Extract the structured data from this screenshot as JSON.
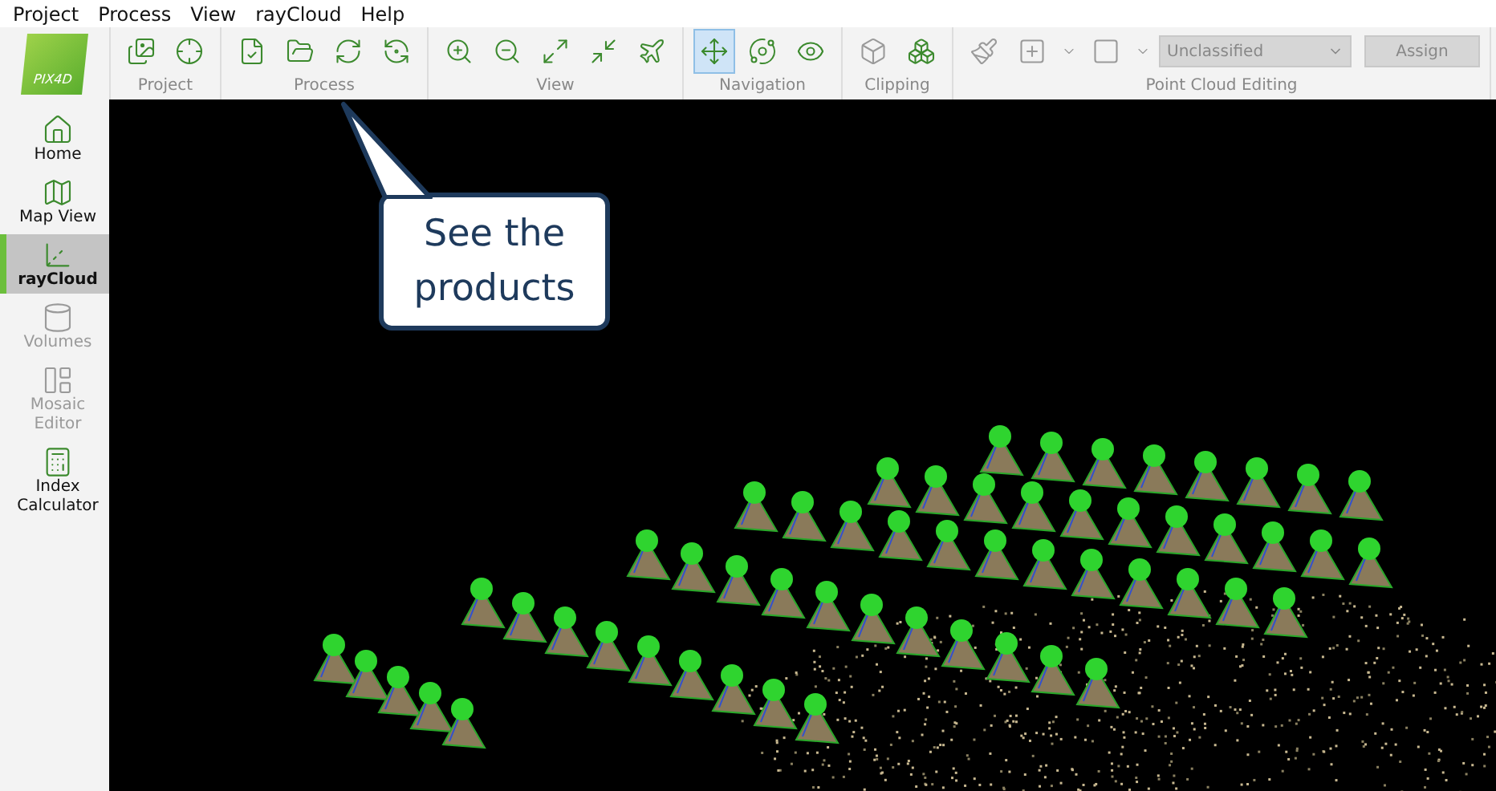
{
  "menu": [
    "Project",
    "Process",
    "View",
    "rayCloud",
    "Help"
  ],
  "logo": {
    "text": "PIX4D"
  },
  "toolbar": [
    {
      "label": "Project",
      "tools": [
        {
          "kind": "photos"
        },
        {
          "kind": "target"
        }
      ]
    },
    {
      "label": "Process",
      "tools": [
        {
          "kind": "check"
        },
        {
          "kind": "folder"
        },
        {
          "kind": "cycle"
        },
        {
          "kind": "cycle-plus"
        }
      ]
    },
    {
      "label": "View",
      "tools": [
        {
          "kind": "zoom-in"
        },
        {
          "kind": "zoom-out"
        },
        {
          "kind": "expand"
        },
        {
          "kind": "shrink"
        },
        {
          "kind": "plane"
        }
      ]
    },
    {
      "label": "Navigation",
      "tools": [
        {
          "kind": "move",
          "selected": true
        },
        {
          "kind": "orbit",
          "selected": false
        },
        {
          "kind": "view",
          "selected": false
        }
      ]
    },
    {
      "label": "Clipping",
      "tools": [
        {
          "kind": "box",
          "disabled": true
        },
        {
          "kind": "box-clip",
          "disabled": false
        }
      ]
    },
    {
      "label": "Point Cloud Editing",
      "tools": [
        {
          "kind": "brush",
          "disabled": true
        },
        {
          "kind": "square-plus",
          "disabled": true
        },
        {
          "kind": "dropdown",
          "disabled": true
        },
        {
          "kind": "square",
          "disabled": true
        },
        {
          "kind": "dropdown",
          "disabled": true
        }
      ],
      "select": {
        "value": "Unclassified",
        "disabled": true
      },
      "button": {
        "label": "Assign",
        "disabled": true
      }
    }
  ],
  "sidebar": [
    {
      "kind": "home",
      "label": "Home",
      "selected": false,
      "disabled": false
    },
    {
      "kind": "map",
      "label": "Map View",
      "selected": false,
      "disabled": false
    },
    {
      "kind": "axes",
      "label": "rayCloud",
      "selected": true,
      "disabled": false
    },
    {
      "kind": "cylinder",
      "label": "Volumes",
      "selected": false,
      "disabled": true
    },
    {
      "kind": "mosaic",
      "label": "Mosaic Editor",
      "selected": false,
      "disabled": true
    },
    {
      "kind": "calculator",
      "label": "Index Calculator",
      "selected": false,
      "disabled": false
    }
  ],
  "callout": {
    "text": "See the products"
  }
}
